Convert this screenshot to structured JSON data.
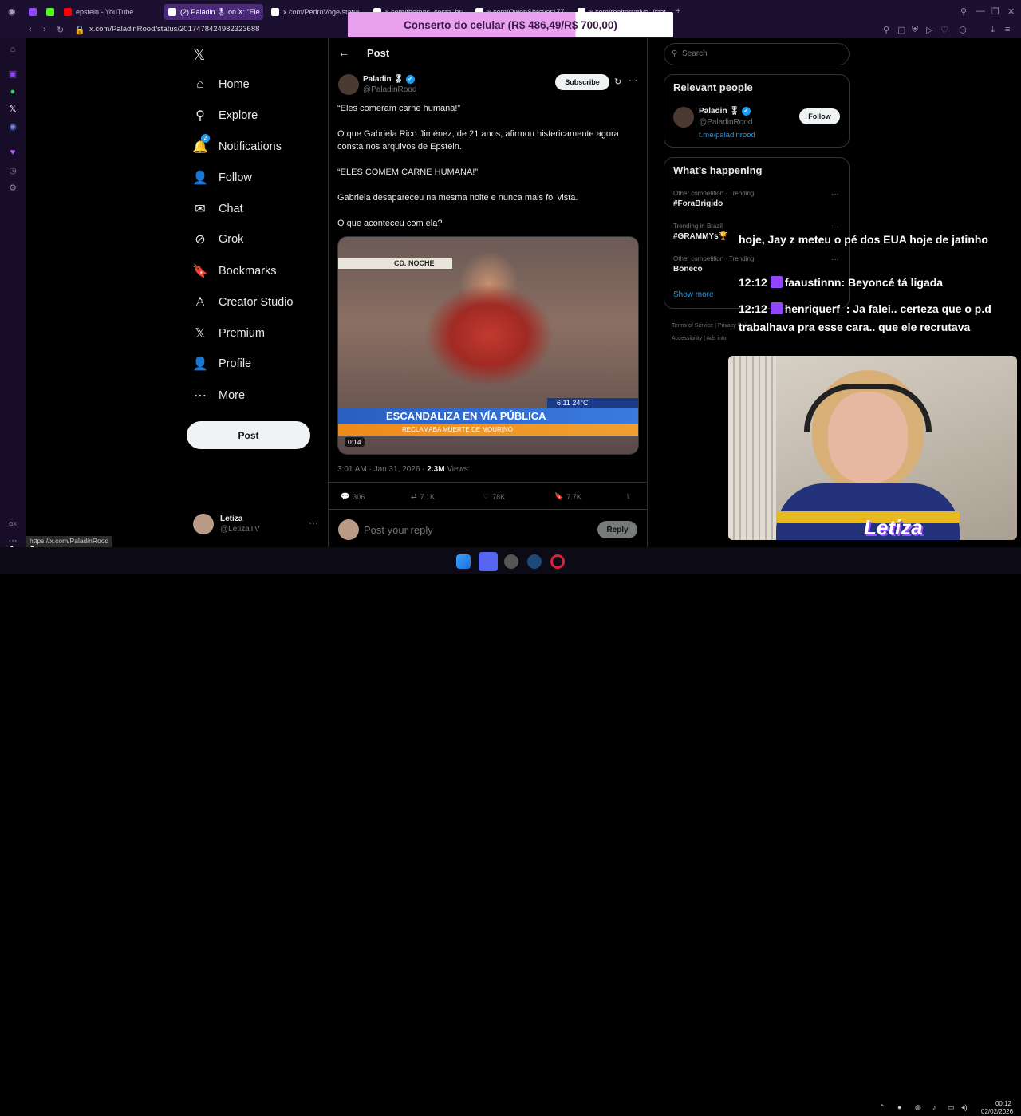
{
  "browser": {
    "tabs": [
      {
        "label": "epstein - YouTube",
        "fav_color": "#ff0000"
      },
      {
        "label": "(2) Paladin 🎖 on X: \"Ele",
        "fav_color": "#ffffff",
        "active": true
      },
      {
        "label": "x.com/PedroVoge/status",
        "fav_color": "#ffffff"
      },
      {
        "label": "x.com/thomas_costa_br/s",
        "fav_color": "#ffffff"
      },
      {
        "label": "x.com/OwenShroyer1776/s",
        "fav_color": "#ffffff"
      },
      {
        "label": "x.com/realterrativo_/stat",
        "fav_color": "#ffffff"
      }
    ],
    "url": "x.com/PaladinRood/status/2017478424982323688",
    "status_url": "https://x.com/PaladinRood"
  },
  "donation": {
    "text": "Conserto do celular (R$ 486,49/R$ 700,00)",
    "progress": 0.695
  },
  "nav": {
    "items": [
      {
        "label": "Home",
        "icon": "home-icon",
        "glyph": "⌂"
      },
      {
        "label": "Explore",
        "icon": "search-icon",
        "glyph": "⚲"
      },
      {
        "label": "Notifications",
        "icon": "bell-icon",
        "glyph": "🔔",
        "badge": "2"
      },
      {
        "label": "Follow",
        "icon": "add-person-icon",
        "glyph": "👤"
      },
      {
        "label": "Chat",
        "icon": "mail-icon",
        "glyph": "✉"
      },
      {
        "label": "Grok",
        "icon": "grok-icon",
        "glyph": "⊘"
      },
      {
        "label": "Bookmarks",
        "icon": "bookmark-icon",
        "glyph": "🔖"
      },
      {
        "label": "Creator Studio",
        "icon": "creator-studio-icon",
        "glyph": "♙"
      },
      {
        "label": "Premium",
        "icon": "x-logo-icon",
        "glyph": "𝕏"
      },
      {
        "label": "Profile",
        "icon": "profile-icon",
        "glyph": "👤"
      },
      {
        "label": "More",
        "icon": "more-circle-icon",
        "glyph": "⋯"
      }
    ],
    "post_button": "Post",
    "account": {
      "name": "Letiza",
      "handle": "@LetizaTV"
    }
  },
  "post": {
    "header": "Post",
    "author": {
      "name": "Paladin 🎖",
      "handle": "@PaladinRood"
    },
    "subscribe_label": "Subscribe",
    "paragraphs": [
      "“Eles comeram carne humana!”",
      "O que Gabriela Rico Jiménez, de 21 anos, afirmou histericamente agora consta nos arquivos de Epstein.",
      "“ELES COMEM CARNE HUMANA!”",
      "Gabriela desapareceu na mesma noite e nunca mais foi vista.",
      "O que aconteceu com ela?"
    ],
    "video": {
      "top_label": "CD. NOCHE",
      "time_label": "6:11  24°C",
      "banner": "ESCANDALIZA EN VÍA PÚBLICA",
      "sub_banner": "RECLAMABA MUERTE DE MOURINO",
      "duration": "0:14"
    },
    "time": "3:01 AM · Jan 31, 2026 ·",
    "views": "2.3M",
    "views_label": "Views",
    "actions": {
      "replies": "306",
      "reposts": "7.1K",
      "likes": "78K",
      "bookmarks": "7.7K"
    },
    "reply_placeholder": "Post your reply",
    "reply_button": "Reply"
  },
  "right": {
    "search_placeholder": "Search",
    "relevant": {
      "title": "Relevant people",
      "name": "Paladin 🎖",
      "handle": "@PaladinRood",
      "link": "t.me/paladinrood",
      "follow_label": "Follow"
    },
    "happening": {
      "title": "What’s happening",
      "items": [
        {
          "context": "Other competition · Trending",
          "tag": "#ForaBrigido"
        },
        {
          "context": "Trending in Brazil",
          "tag": "#GRAMMYs🏆"
        },
        {
          "context": "Other competition · Trending",
          "tag": "Boneco"
        }
      ],
      "show_more": "Show more"
    },
    "footer": [
      "Terms of Service",
      "Privacy Policy",
      "Cookie Policy",
      "Accessibility",
      "Ads info",
      "More ···",
      "© 2026 X Corp."
    ]
  },
  "chat": [
    {
      "time": "",
      "user": "",
      "text": "hoje, Jay z meteu o pé dos EUA hoje de jatinho"
    },
    {
      "time": "12:12",
      "user": "faaustinnn",
      "text": "Beyoncé tá ligada"
    },
    {
      "time": "12:12",
      "user": "henriquerf_",
      "text": "Ja falei.. certeza que o p.d trabalhava pra esse cara.. que ele recrutava"
    }
  ],
  "stream": {
    "logo_text": "letiza",
    "handle": "letizatv",
    "cam_logo": "Letiza"
  },
  "taskbar": {
    "time": "00:12",
    "date": "02/02/2026"
  }
}
